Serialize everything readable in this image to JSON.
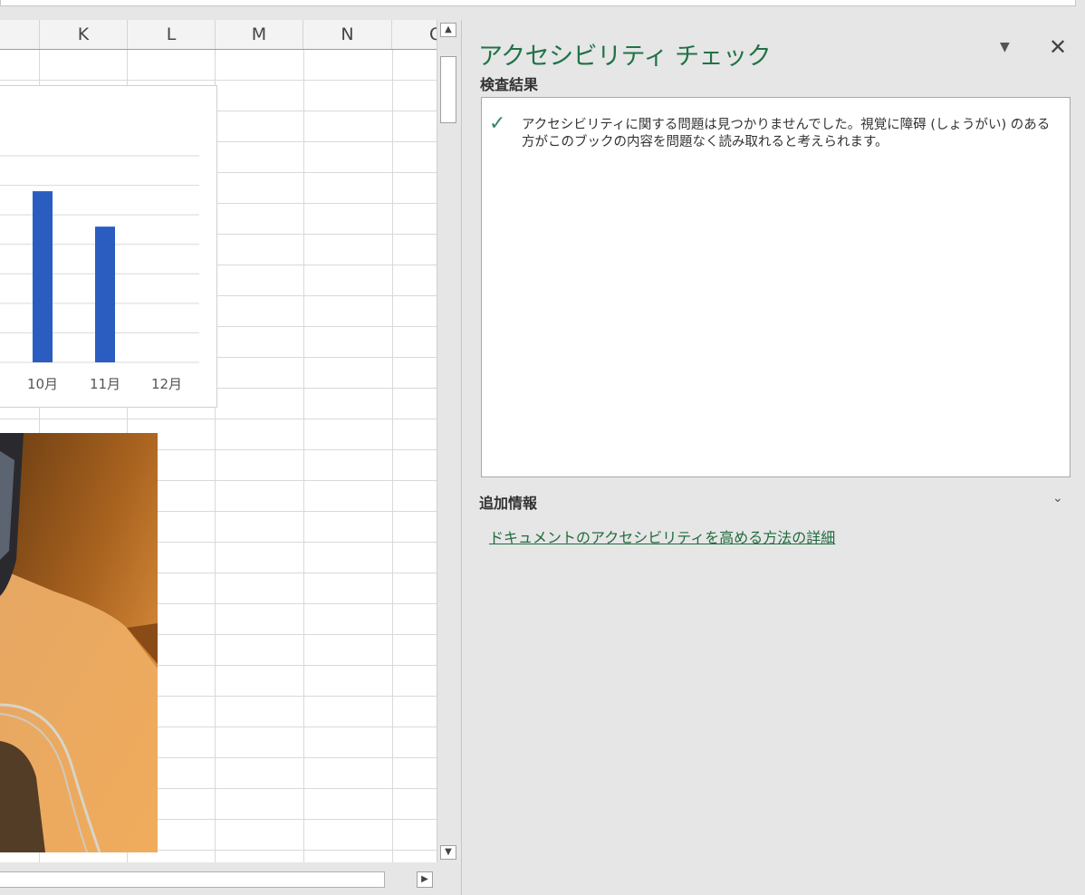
{
  "sheet": {
    "columns": [
      "K",
      "L",
      "M",
      "N",
      "O"
    ]
  },
  "chart_data": {
    "type": "bar",
    "categories": [
      "10月",
      "11月",
      "12月"
    ],
    "values": [
      5.8,
      4.6,
      0
    ],
    "ylim": [
      0,
      7
    ],
    "grid": true,
    "colors": {
      "bar": "#2a5dbf"
    }
  },
  "pane": {
    "title": "アクセシビリティ チェック",
    "results_label": "検査結果",
    "result_message": "アクセシビリティに関する問題は見つかりませんでした。視覚に障碍 (しょうがい) のある方がこのブックの内容を問題なく読み取れると考えられます。",
    "additional_info_label": "追加情報",
    "help_link": "ドキュメントのアクセシビリティを高める方法の詳細",
    "icons": {
      "check": "✓",
      "menu": "▼",
      "close": "✕",
      "chevron": "⌄"
    },
    "accent_color": "#217346"
  },
  "scrollbar": {
    "up": "▲",
    "down": "▼",
    "right": "▶"
  }
}
